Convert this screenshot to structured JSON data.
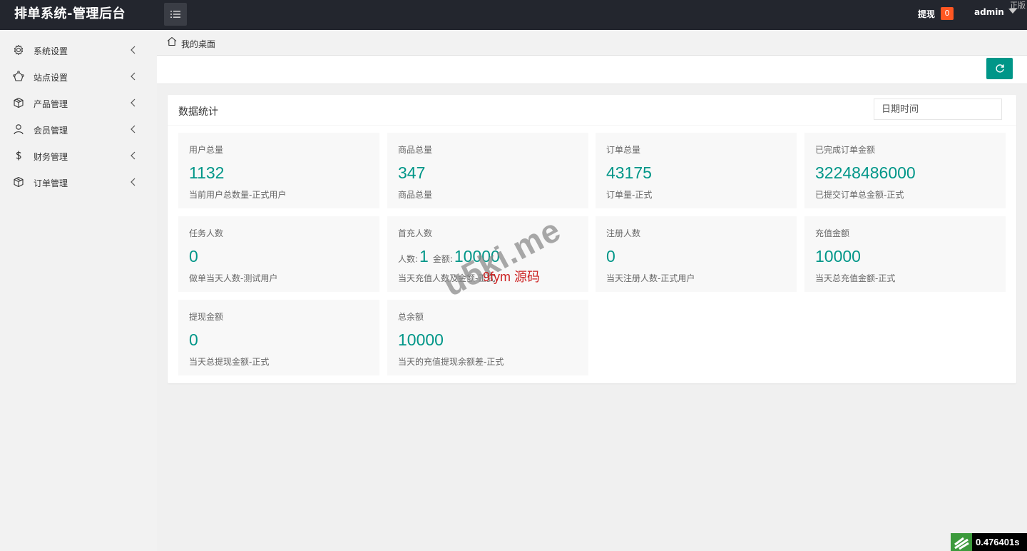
{
  "header": {
    "app_title": "排单系统-管理后台",
    "withdraw_label": "提现",
    "withdraw_count": "0",
    "user_name": "admin",
    "corner_text": "正版"
  },
  "sidebar": {
    "items": [
      {
        "label": "系统设置",
        "icon": "gear-icon"
      },
      {
        "label": "站点设置",
        "icon": "site-icon"
      },
      {
        "label": "产品管理",
        "icon": "box-icon"
      },
      {
        "label": "会员管理",
        "icon": "user-icon"
      },
      {
        "label": "财务管理",
        "icon": "dollar-icon"
      },
      {
        "label": "订单管理",
        "icon": "box-icon"
      }
    ]
  },
  "breadcrumb": {
    "home": "我的桌面"
  },
  "card": {
    "title": "数据统计",
    "date_placeholder": "日期时间",
    "stats": [
      {
        "title": "用户总量",
        "value": "1132",
        "desc": "当前用户总数量-正式用户"
      },
      {
        "title": "商品总量",
        "value": "347",
        "desc": "商品总量"
      },
      {
        "title": "订单总量",
        "value": "43175",
        "desc": "订单量-正式"
      },
      {
        "title": "已完成订单金额",
        "value": "32248486000",
        "desc": "已提交订单总金额-正式"
      },
      {
        "title": "任务人数",
        "value": "0",
        "desc": "做单当天人数-测试用户"
      },
      {
        "title": "首充人数",
        "people_label": "人数:",
        "people_value": "1",
        "amount_label": "金额:",
        "amount_value": "10000",
        "desc": "当天充值人数及金额-正式"
      },
      {
        "title": "注册人数",
        "value": "0",
        "desc": "当天注册人数-正式用户"
      },
      {
        "title": "充值金额",
        "value": "10000",
        "desc": "当天总充值金额-正式"
      },
      {
        "title": "提现金额",
        "value": "0",
        "desc": "当天总提现金额-正式"
      },
      {
        "title": "总余额",
        "value": "10000",
        "desc": "当天的充值提现余额差-正式"
      }
    ]
  },
  "watermark": {
    "site": "u5ki.me",
    "label": "9fym 源码"
  },
  "timer": {
    "text": "0.476401s"
  },
  "colors": {
    "accent": "#009688",
    "header_bg": "#23262e",
    "badge": "#ff5722"
  }
}
